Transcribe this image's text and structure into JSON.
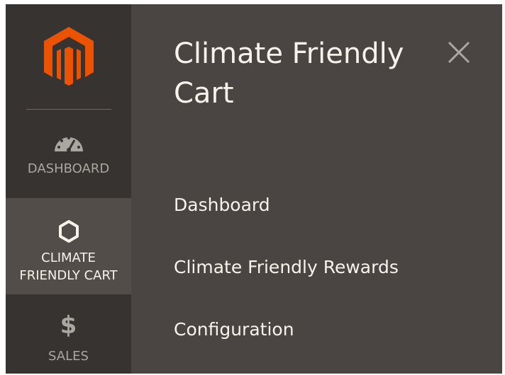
{
  "sidebar": {
    "logo": {
      "icon": "magento-logo-icon",
      "color": "#eb5202"
    },
    "items": [
      {
        "label": "DASHBOARD",
        "icon": "speedometer-icon",
        "active": false
      },
      {
        "label": "CLIMATE FRIENDLY CART",
        "icon": "hexagon-icon",
        "active": true
      },
      {
        "label": "SALES",
        "icon": "dollar-icon",
        "glyph": "$",
        "active": false
      }
    ]
  },
  "panel": {
    "title": "Climate Friendly Cart",
    "close_icon": "close-icon",
    "items": [
      {
        "label": "Dashboard"
      },
      {
        "label": "Climate Friendly Rewards"
      },
      {
        "label": "Configuration"
      }
    ]
  },
  "colors": {
    "sidebar_bg": "#373330",
    "active_bg": "#524d49",
    "panel_bg": "#4a4542",
    "text_light": "#f7f3eb",
    "text_muted": "#aaa6a0",
    "accent": "#eb5202"
  }
}
